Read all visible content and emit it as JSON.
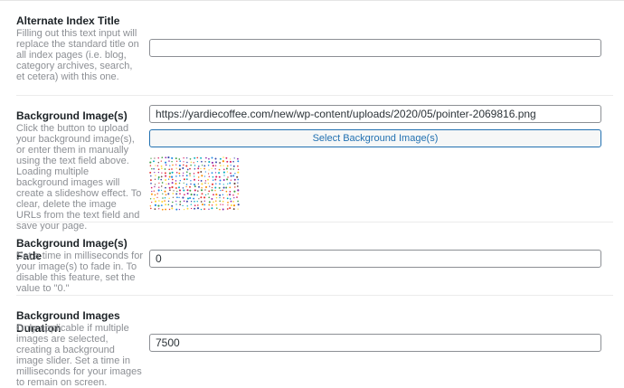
{
  "sections": [
    {
      "title": "Alternate Index Title",
      "description": "Filling out this text input will replace the standard title on all index pages (i.e. blog, category archives, search, et cetera) with this one.",
      "value": ""
    },
    {
      "title": "Background Image(s)",
      "description": "Click the button to upload your background image(s), or enter them in manually using the text field above. Loading multiple background images will create a slideshow effect. To clear, delete the image URLs from the text field and save your page.",
      "value": "https://yardiecoffee.com/new/wp-content/uploads/2020/05/pointer-2069816.png",
      "button_label": "Select Background Image(s)"
    },
    {
      "title": "Background Image(s) Fade",
      "description": "Set a time in milliseconds for your image(s) to fade in. To disable this feature, set the value to \"0.\"",
      "value": "0"
    },
    {
      "title": "Background Images Duration",
      "description": "Only applicable if multiple images are selected, creating a background image slider. Set a time in milliseconds for your images to remain on screen.",
      "value": "7500"
    }
  ]
}
